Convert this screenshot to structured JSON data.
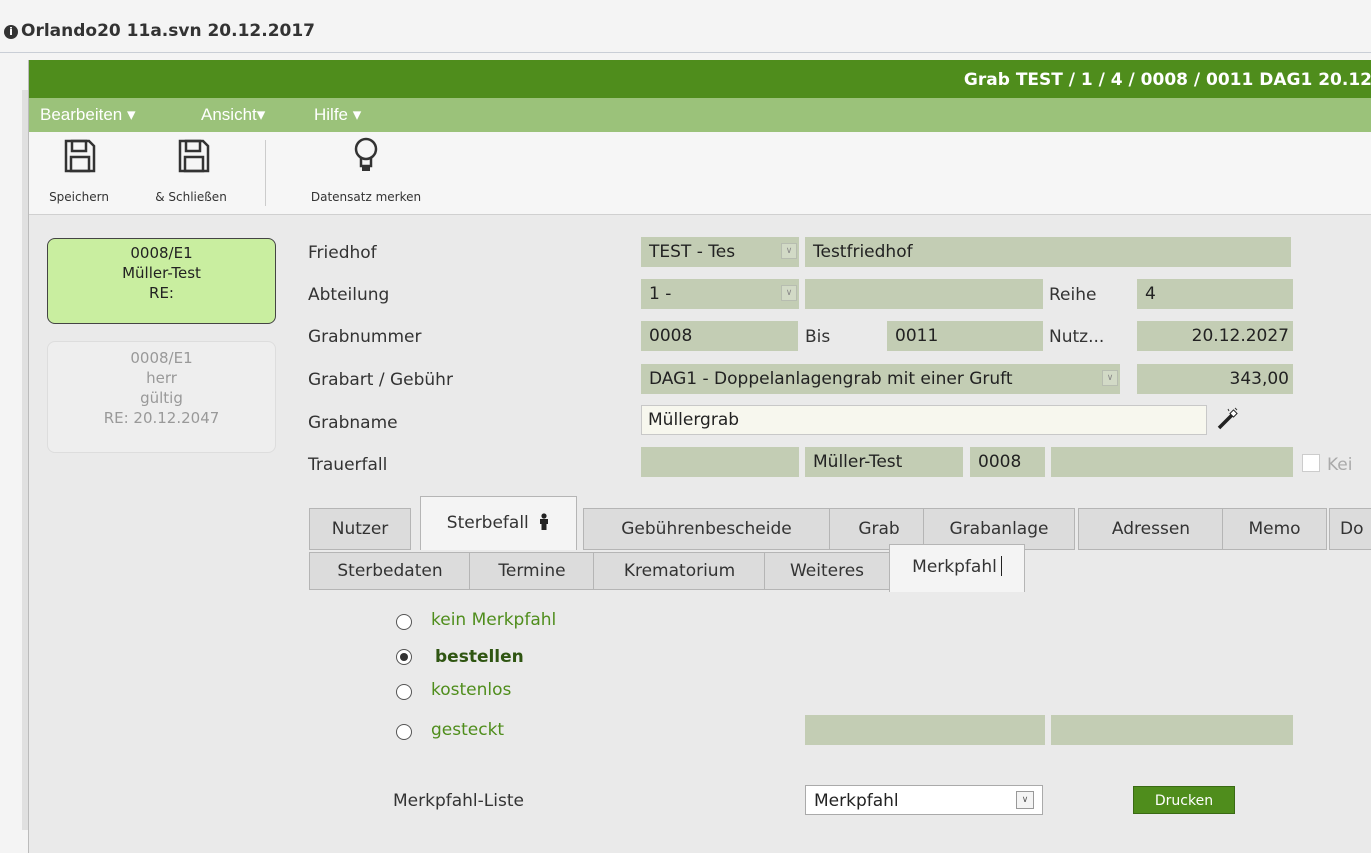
{
  "app": {
    "info_title": "Orlando20 11a.svn 20.12.2017"
  },
  "window": {
    "title": "Grab TEST / 1 / 4 / 0008 / 0011 DAG1 20.12"
  },
  "menu": [
    {
      "label": "Bearbeiten"
    },
    {
      "label": "Ansicht"
    },
    {
      "label": "Hilfe"
    }
  ],
  "toolbar": {
    "save": "Speichern",
    "save_close": "& Schließen",
    "remember": "Datensatz merken"
  },
  "cards": [
    {
      "line1": "0008/E1",
      "line2": "Müller-Test",
      "line3": "RE:",
      "line4": ""
    },
    {
      "line1": "0008/E1",
      "line2": "herr",
      "line3": "gültig",
      "line4": "RE: 20.12.2047"
    }
  ],
  "form": {
    "friedhof_label": "Friedhof",
    "friedhof_code": "TEST - Tes",
    "friedhof_name": "Testfriedhof",
    "abteilung_label": "Abteilung",
    "abteilung_value": "1 -",
    "abteilung_text": "",
    "reihe_label": "Reihe",
    "reihe_value": "4",
    "grabnummer_label": "Grabnummer",
    "grabnummer_value": "0008",
    "bis_label": "Bis",
    "bis_value": "0011",
    "nutz_label": "Nutz...",
    "nutz_value": "20.12.2027",
    "grabart_label": "Grabart / Gebühr",
    "grabart_value": "DAG1 - Doppelanlagengrab mit einer Gruft",
    "gebuehr_value": "343,00",
    "grabname_label": "Grabname",
    "grabname_value": "Müllergrab",
    "trauerfall_label": "Trauerfall",
    "trauerfall_name": "Müller-Test",
    "trauerfall_nr": "0008",
    "kein_label": "Kei"
  },
  "tabs": [
    {
      "label": "Nutzer"
    },
    {
      "label": "Sterbefall"
    },
    {
      "label": "Gebührenbescheide"
    },
    {
      "label": "Grab"
    },
    {
      "label": "Grabanlage"
    },
    {
      "label": "Adressen"
    },
    {
      "label": "Memo"
    },
    {
      "label": "Do"
    }
  ],
  "subtabs": [
    {
      "label": "Sterbedaten"
    },
    {
      "label": "Termine"
    },
    {
      "label": "Krematorium"
    },
    {
      "label": "Weiteres"
    },
    {
      "label": "Merkpfahl"
    }
  ],
  "merkpfahl": {
    "options": [
      {
        "label": "kein Merkpfahl",
        "selected": false
      },
      {
        "label": "bestellen",
        "selected": true
      },
      {
        "label": "kostenlos",
        "selected": false
      },
      {
        "label": "gesteckt",
        "selected": false
      }
    ],
    "liste_label": "Merkpfahl-Liste",
    "liste_value": "Merkpfahl",
    "print_button": "Drucken"
  },
  "colors": {
    "accent": "#4f8d1c",
    "menubar": "#9bc27a",
    "field": "#c3cdb4",
    "card_active": "#c9eea0"
  }
}
